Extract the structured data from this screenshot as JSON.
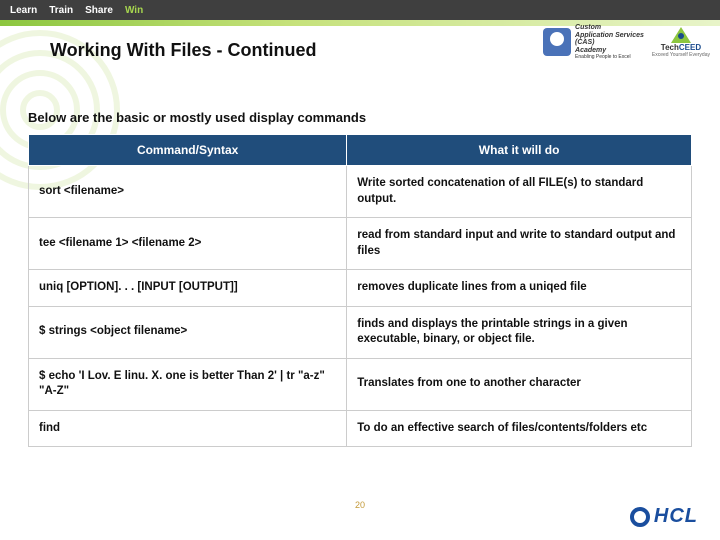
{
  "topnav": {
    "items": [
      "Learn",
      "Train",
      "Share",
      "Win"
    ]
  },
  "logos": {
    "cas": {
      "line1": "Custom",
      "line2": "Application Services",
      "line3": "(CAS)",
      "line4": "Academy",
      "tagline": "Enabling People to Excel"
    },
    "techceed": {
      "brand_prefix": "Tech",
      "brand_suffix": "CEED",
      "tagline": "Exceed Yourself Everyday"
    }
  },
  "title": "Working With Files - Continued",
  "subtitle": "Below are the basic or mostly used display commands",
  "table": {
    "headers": [
      "Command/Syntax",
      "What it will do"
    ],
    "rows": [
      {
        "cmd": "sort <filename>",
        "desc": "Write sorted concatenation of all FILE(s) to standard output."
      },
      {
        "cmd": "tee <filename 1> <filename 2>",
        "desc": "read from standard input and write to standard output and files"
      },
      {
        "cmd": "uniq [OPTION]. . . [INPUT [OUTPUT]]",
        "desc": "removes duplicate lines from a uniqed file"
      },
      {
        "cmd": "$ strings <object filename>",
        "desc": "finds and displays the printable strings in a given executable, binary, or object file."
      },
      {
        "cmd": "$ echo 'I Lov. E linu. X. one is better Than 2' | tr \"a-z\" \"A-Z\"",
        "desc": "Translates from one to another character"
      },
      {
        "cmd": "find",
        "desc": "To do an effective search of files/contents/folders etc"
      }
    ]
  },
  "page_number": "20",
  "hcl": {
    "label": "HCL"
  }
}
